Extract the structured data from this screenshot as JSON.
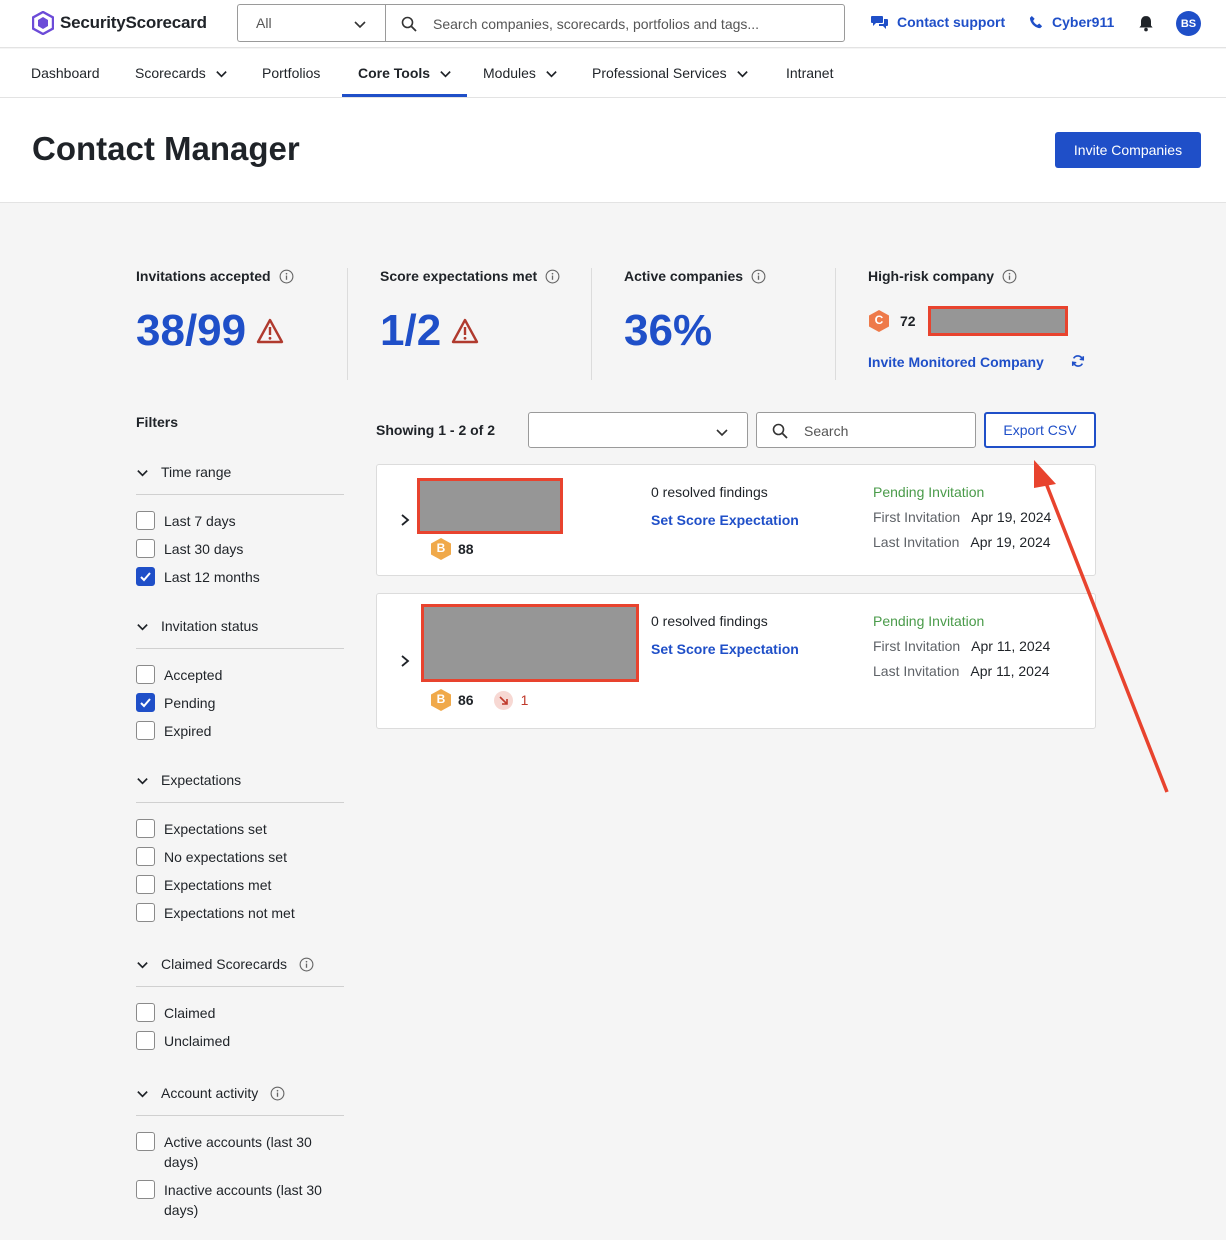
{
  "header": {
    "brand": "SecurityScorecard",
    "scope_select": "All",
    "search_placeholder": "Search companies, scorecards, portfolios and tags...",
    "contact_support": "Contact support",
    "cyber911": "Cyber911",
    "avatar_initials": "BS"
  },
  "nav": {
    "items": [
      "Dashboard",
      "Scorecards",
      "Portfolios",
      "Core Tools",
      "Modules",
      "Professional Services",
      "Intranet"
    ],
    "active": "Core Tools"
  },
  "page": {
    "title": "Contact Manager",
    "invite_button": "Invite Companies"
  },
  "stats": {
    "invitations_label": "Invitations accepted",
    "invitations_value": "38/99",
    "expectations_label": "Score expectations met",
    "expectations_value": "1/2",
    "active_label": "Active companies",
    "active_value": "36%",
    "high_risk_label": "High-risk company",
    "high_risk_grade": "C",
    "high_risk_score": "72",
    "invite_monitored": "Invite Monitored Company"
  },
  "filters": {
    "title": "Filters",
    "groups": [
      {
        "label": "Time range",
        "options": [
          {
            "label": "Last 7 days",
            "checked": false
          },
          {
            "label": "Last 30 days",
            "checked": false
          },
          {
            "label": "Last 12 months",
            "checked": true
          }
        ]
      },
      {
        "label": "Invitation status",
        "options": [
          {
            "label": "Accepted",
            "checked": false
          },
          {
            "label": "Pending",
            "checked": true
          },
          {
            "label": "Expired",
            "checked": false
          }
        ]
      },
      {
        "label": "Expectations",
        "options": [
          {
            "label": "Expectations set",
            "checked": false
          },
          {
            "label": "No expectations set",
            "checked": false
          },
          {
            "label": "Expectations met",
            "checked": false
          },
          {
            "label": "Expectations not met",
            "checked": false
          }
        ]
      },
      {
        "label": "Claimed Scorecards",
        "options": [
          {
            "label": "Claimed",
            "checked": false
          },
          {
            "label": "Unclaimed",
            "checked": false
          }
        ]
      },
      {
        "label": "Account activity",
        "options": [
          {
            "label": "Active accounts (last 30 days)",
            "checked": false
          },
          {
            "label": "Inactive accounts (last 30 days)",
            "checked": false
          }
        ]
      }
    ]
  },
  "list": {
    "showing": "Showing 1 - 2 of 2",
    "search_placeholder": "Search",
    "export_button": "Export CSV",
    "rows": [
      {
        "grade": "B",
        "score": "88",
        "findings": "0 resolved findings",
        "set_expectation": "Set Score Expectation",
        "status": "Pending Invitation",
        "first_label": "First Invitation",
        "first_date": "Apr 19, 2024",
        "last_label": "Last Invitation",
        "last_date": "Apr 19, 2024"
      },
      {
        "grade": "B",
        "score": "86",
        "trend": "1",
        "findings": "0 resolved findings",
        "set_expectation": "Set Score Expectation",
        "status": "Pending Invitation",
        "first_label": "First Invitation",
        "first_date": "Apr 11, 2024",
        "last_label": "Last Invitation",
        "last_date": "Apr 11, 2024"
      }
    ]
  },
  "colors": {
    "accent": "#1f4fc8",
    "annotation": "#e8432e",
    "grade_b": "#f0a94a",
    "grade_c": "#ee7a4a",
    "pending": "#4a9b4a"
  }
}
